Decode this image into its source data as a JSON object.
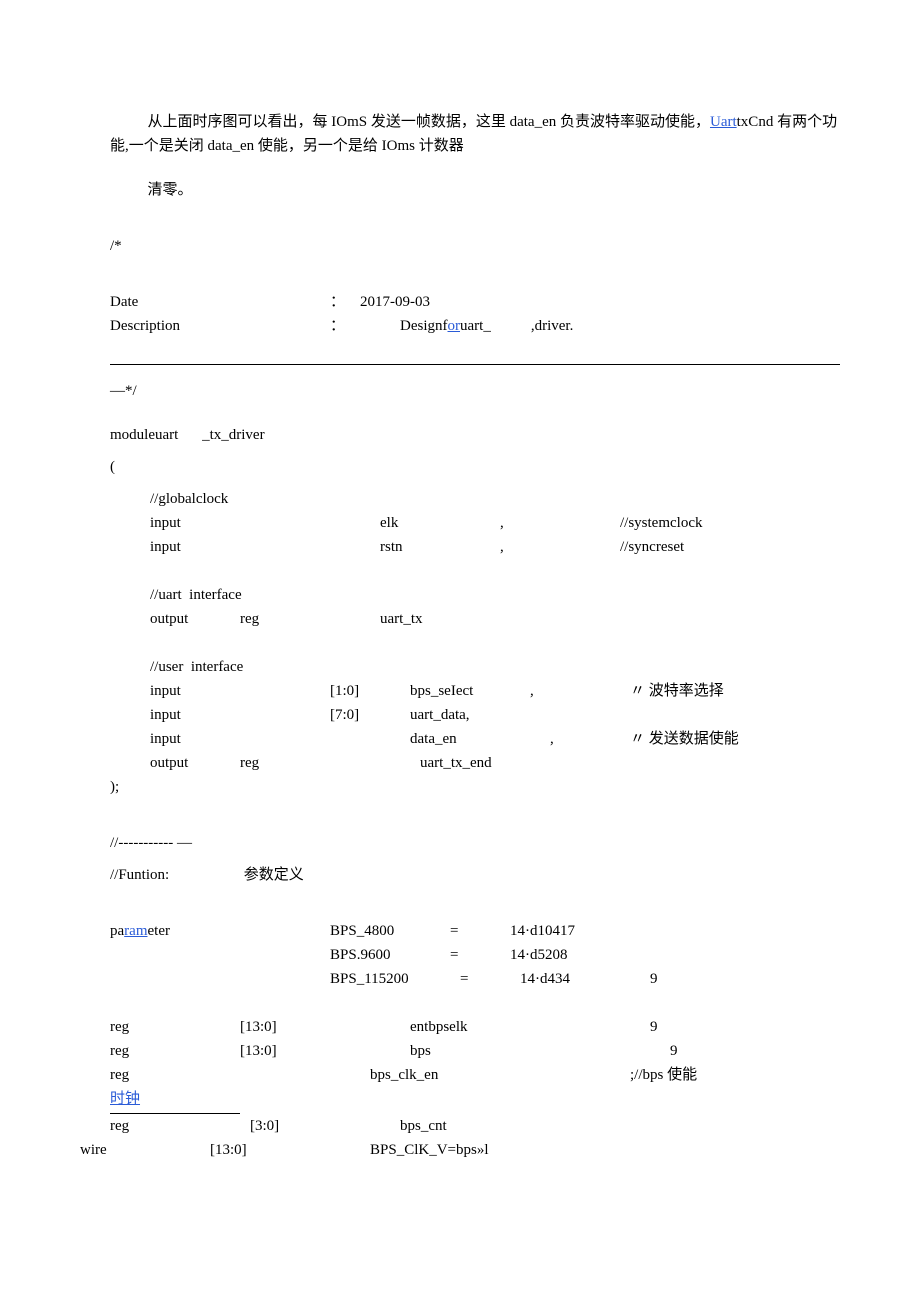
{
  "intro": {
    "para1_prefix": "从上面时序图可以看出，每 IOmS 发送一帧数据，这里 data_en 负责波特率驱动使能，",
    "para1_link": "Uart",
    "para1_suffix": "txCnd 有两个功能,一个是关闭 data_en 使能，另一个是给 IOms 计数器",
    "para2": "清零。",
    "comment_open": "/*"
  },
  "header": {
    "date_label": "Date",
    "colon": "：",
    "date_value": "2017-09-03",
    "desc_label": "Description",
    "desc_prefix": "Designf",
    "desc_link": "or",
    "desc_mid": "uart_",
    "desc_suffix": ",driver."
  },
  "close_comment": "—*/",
  "module": {
    "decl_prefix": "moduleuart",
    "decl_suffix": " _tx_driver",
    "open_paren": "(",
    "close_paren": ");",
    "global_comment": "//globalclock",
    "sys_clock": {
      "kw": "input",
      "name": "elk",
      "punc": ",",
      "comment": "//systemclock"
    },
    "rstn": {
      "kw": "input",
      "name": "rstn",
      "punc": ",",
      "comment": "//syncreset"
    },
    "uart_if_comment": "//uart  interface",
    "uart_tx": {
      "kw": "output",
      "mod": "reg",
      "name": "uart_tx"
    },
    "user_if_comment": "//user  interface",
    "bps_select": {
      "kw": "input",
      "range": "[1:0]",
      "name": "bps_seIect",
      "punc": ",",
      "comment": "〃 波特率选择"
    },
    "uart_data": {
      "kw": "input",
      "range": "[7:0]",
      "name": "uart_data,"
    },
    "data_en": {
      "kw": "input",
      "name": "data_en",
      "punc": ",",
      "comment": "〃 发送数据使能"
    },
    "uart_tx_end": {
      "kw": "output",
      "mod": "reg",
      "name": "uart_tx_end"
    }
  },
  "funtion": {
    "dashes": "//----------- —",
    "label": "//Funtion:",
    "text": "参数定义"
  },
  "params": {
    "param_label_pre": "pa",
    "param_label_link": "ram",
    "param_label_post": "eter",
    "p1": {
      "name": "BPS_4800",
      "eq": "=",
      "val": "14·d10417"
    },
    "p2": {
      "name": "BPS.9600",
      "eq": "=",
      "val": "14·d5208"
    },
    "p3": {
      "name": "BPS_115200",
      "eq": "=",
      "val": "14·d434",
      "end": "9"
    }
  },
  "regs": {
    "r1": {
      "kw": "reg",
      "range": "[13:0]",
      "name": "entbpselk",
      "end": "9"
    },
    "r2": {
      "kw": "reg",
      "range": "[13:0]",
      "name": "bps",
      "end": "9"
    },
    "r3": {
      "kw": "reg",
      "name": "bps_clk_en",
      "comment": ";//bps 使能"
    },
    "clock_link": "时钟",
    "r4": {
      "kw": "reg",
      "range": "[3:0]",
      "name": "bps_cnt"
    },
    "w1": {
      "kw": "wire",
      "range": "[13:0]",
      "name": "BPS_ClK_V=bps»l"
    }
  }
}
